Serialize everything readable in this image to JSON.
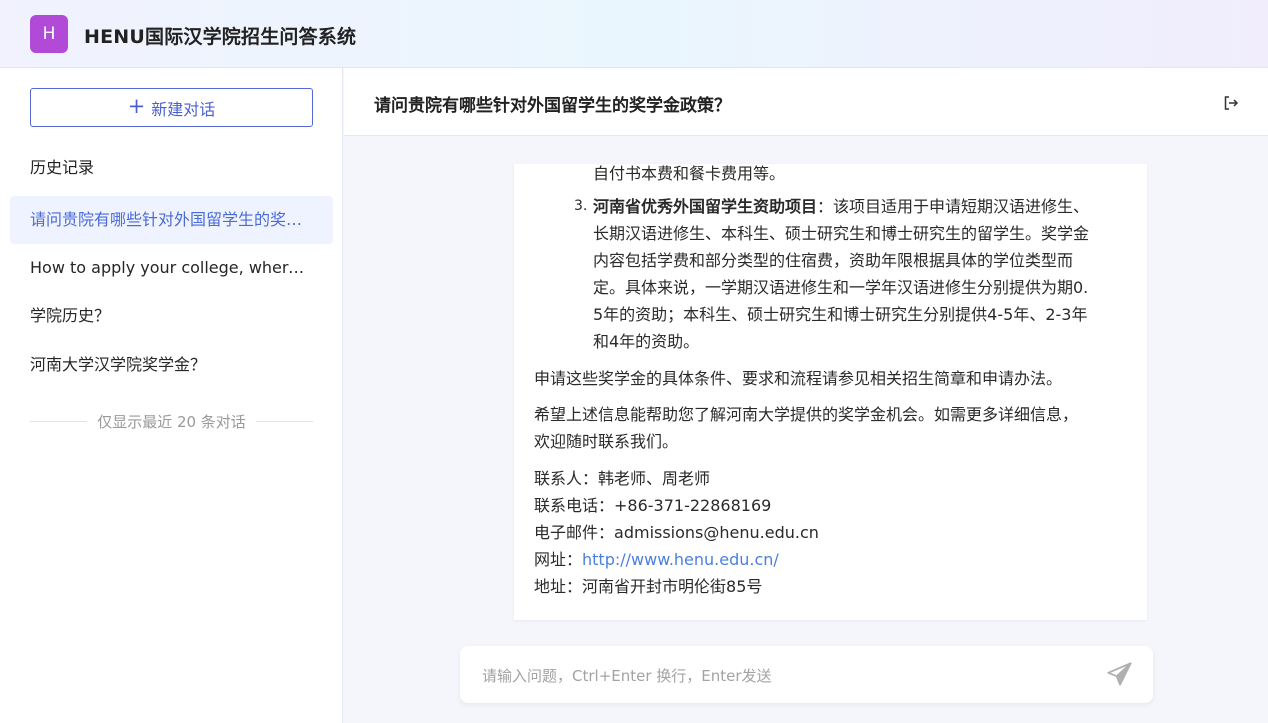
{
  "app": {
    "logo_letter": "H",
    "title": "HENU国际汉学院招生问答系统"
  },
  "sidebar": {
    "new_chat_label": "新建对话",
    "history_title": "历史记录",
    "items": [
      {
        "label": "请问贵院有哪些针对外国留学生的奖学金政策？"
      },
      {
        "label": "How to apply your college, where is the application portal?"
      },
      {
        "label": "学院历史？"
      },
      {
        "label": "河南大学汉学院奖学金？"
      }
    ],
    "limit_note": "仅显示最近 20 条对话"
  },
  "chat": {
    "title": "请问贵院有哪些针对外国留学生的奖学金政策？",
    "message": {
      "line_prev": "自付书本费和餐卡费用等。",
      "item3_num": "3.",
      "item3_bold": "河南省优秀外国留学生资助项目",
      "item3_l1": "：该项目适用于申请短期汉语进修生、",
      "item3_l2": "长期汉语进修生、本科生、硕士研究生和博士研究生的留学生。奖学金",
      "item3_l3": "内容包括学费和部分类型的住宿费，资助年限根据具体的学位类型而",
      "item3_l4": "定。具体来说，一学期汉语进修生和一学年汉语进修生分别提供为期0.",
      "item3_l5": "5年的资助；本科生、硕士研究生和博士研究生分别提供4-5年、2-3年",
      "item3_l6": "和4年的资助。",
      "para1": "申请这些奖学金的具体条件、要求和流程请参见相关招生简章和申请办法。",
      "para2_l1": "希望上述信息能帮助您了解河南大学提供的奖学金机会。如需更多详细信息，",
      "para2_l2": "欢迎随时联系我们。",
      "contact_label": "联系人：",
      "contact_value": "韩老师、周老师",
      "phone_label": "联系电话：",
      "phone_value": "+86-371-22868169",
      "email_label": "电子邮件：",
      "email_value": "admissions@henu.edu.cn",
      "site_label": "网址：",
      "site_value": "http://www.henu.edu.cn/",
      "address_label": "地址：",
      "address_value": "河南省开封市明伦街85号"
    },
    "input_placeholder": "请输入问题，Ctrl+Enter 换行，Enter发送"
  },
  "colors": {
    "accent": "#4a5fd2",
    "logo": "#b24ad8",
    "link": "#4a7fe0",
    "active_bg": "#eef3ff"
  },
  "icons": {
    "logout": "logout-icon",
    "send": "send-icon",
    "plus": "plus-icon"
  }
}
